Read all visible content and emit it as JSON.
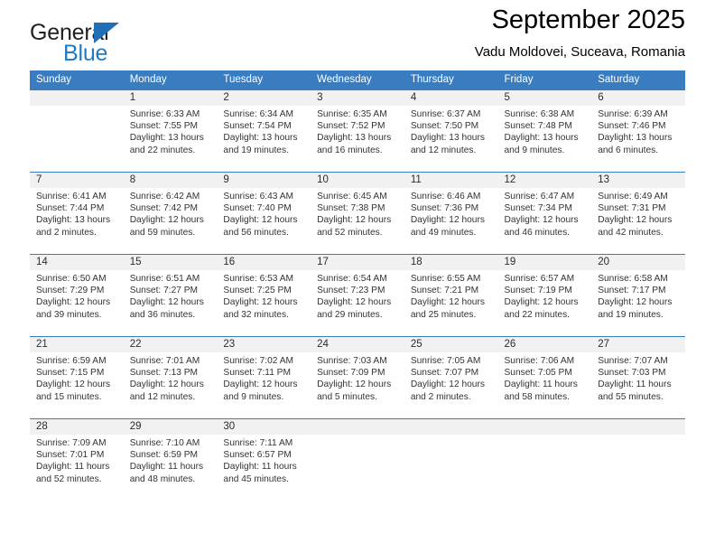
{
  "brand": {
    "name_part1": "General",
    "name_part2": "Blue",
    "accent_color": "#1f7ac4",
    "triangle_color": "#1f6fb5"
  },
  "header": {
    "title": "September 2025",
    "location": "Vadu Moldovei, Suceava, Romania"
  },
  "calendar": {
    "header_bg": "#3a7cc0",
    "daynum_band_bg": "#f1f1f1",
    "weekday_headers": [
      "Sunday",
      "Monday",
      "Tuesday",
      "Wednesday",
      "Thursday",
      "Friday",
      "Saturday"
    ],
    "weeks": [
      [
        {
          "day": "",
          "sunrise": "",
          "sunset": "",
          "daylight1": "",
          "daylight2": ""
        },
        {
          "day": "1",
          "sunrise": "Sunrise: 6:33 AM",
          "sunset": "Sunset: 7:55 PM",
          "daylight1": "Daylight: 13 hours",
          "daylight2": "and 22 minutes."
        },
        {
          "day": "2",
          "sunrise": "Sunrise: 6:34 AM",
          "sunset": "Sunset: 7:54 PM",
          "daylight1": "Daylight: 13 hours",
          "daylight2": "and 19 minutes."
        },
        {
          "day": "3",
          "sunrise": "Sunrise: 6:35 AM",
          "sunset": "Sunset: 7:52 PM",
          "daylight1": "Daylight: 13 hours",
          "daylight2": "and 16 minutes."
        },
        {
          "day": "4",
          "sunrise": "Sunrise: 6:37 AM",
          "sunset": "Sunset: 7:50 PM",
          "daylight1": "Daylight: 13 hours",
          "daylight2": "and 12 minutes."
        },
        {
          "day": "5",
          "sunrise": "Sunrise: 6:38 AM",
          "sunset": "Sunset: 7:48 PM",
          "daylight1": "Daylight: 13 hours",
          "daylight2": "and 9 minutes."
        },
        {
          "day": "6",
          "sunrise": "Sunrise: 6:39 AM",
          "sunset": "Sunset: 7:46 PM",
          "daylight1": "Daylight: 13 hours",
          "daylight2": "and 6 minutes."
        }
      ],
      [
        {
          "day": "7",
          "sunrise": "Sunrise: 6:41 AM",
          "sunset": "Sunset: 7:44 PM",
          "daylight1": "Daylight: 13 hours",
          "daylight2": "and 2 minutes."
        },
        {
          "day": "8",
          "sunrise": "Sunrise: 6:42 AM",
          "sunset": "Sunset: 7:42 PM",
          "daylight1": "Daylight: 12 hours",
          "daylight2": "and 59 minutes."
        },
        {
          "day": "9",
          "sunrise": "Sunrise: 6:43 AM",
          "sunset": "Sunset: 7:40 PM",
          "daylight1": "Daylight: 12 hours",
          "daylight2": "and 56 minutes."
        },
        {
          "day": "10",
          "sunrise": "Sunrise: 6:45 AM",
          "sunset": "Sunset: 7:38 PM",
          "daylight1": "Daylight: 12 hours",
          "daylight2": "and 52 minutes."
        },
        {
          "day": "11",
          "sunrise": "Sunrise: 6:46 AM",
          "sunset": "Sunset: 7:36 PM",
          "daylight1": "Daylight: 12 hours",
          "daylight2": "and 49 minutes."
        },
        {
          "day": "12",
          "sunrise": "Sunrise: 6:47 AM",
          "sunset": "Sunset: 7:34 PM",
          "daylight1": "Daylight: 12 hours",
          "daylight2": "and 46 minutes."
        },
        {
          "day": "13",
          "sunrise": "Sunrise: 6:49 AM",
          "sunset": "Sunset: 7:31 PM",
          "daylight1": "Daylight: 12 hours",
          "daylight2": "and 42 minutes."
        }
      ],
      [
        {
          "day": "14",
          "sunrise": "Sunrise: 6:50 AM",
          "sunset": "Sunset: 7:29 PM",
          "daylight1": "Daylight: 12 hours",
          "daylight2": "and 39 minutes."
        },
        {
          "day": "15",
          "sunrise": "Sunrise: 6:51 AM",
          "sunset": "Sunset: 7:27 PM",
          "daylight1": "Daylight: 12 hours",
          "daylight2": "and 36 minutes."
        },
        {
          "day": "16",
          "sunrise": "Sunrise: 6:53 AM",
          "sunset": "Sunset: 7:25 PM",
          "daylight1": "Daylight: 12 hours",
          "daylight2": "and 32 minutes."
        },
        {
          "day": "17",
          "sunrise": "Sunrise: 6:54 AM",
          "sunset": "Sunset: 7:23 PM",
          "daylight1": "Daylight: 12 hours",
          "daylight2": "and 29 minutes."
        },
        {
          "day": "18",
          "sunrise": "Sunrise: 6:55 AM",
          "sunset": "Sunset: 7:21 PM",
          "daylight1": "Daylight: 12 hours",
          "daylight2": "and 25 minutes."
        },
        {
          "day": "19",
          "sunrise": "Sunrise: 6:57 AM",
          "sunset": "Sunset: 7:19 PM",
          "daylight1": "Daylight: 12 hours",
          "daylight2": "and 22 minutes."
        },
        {
          "day": "20",
          "sunrise": "Sunrise: 6:58 AM",
          "sunset": "Sunset: 7:17 PM",
          "daylight1": "Daylight: 12 hours",
          "daylight2": "and 19 minutes."
        }
      ],
      [
        {
          "day": "21",
          "sunrise": "Sunrise: 6:59 AM",
          "sunset": "Sunset: 7:15 PM",
          "daylight1": "Daylight: 12 hours",
          "daylight2": "and 15 minutes."
        },
        {
          "day": "22",
          "sunrise": "Sunrise: 7:01 AM",
          "sunset": "Sunset: 7:13 PM",
          "daylight1": "Daylight: 12 hours",
          "daylight2": "and 12 minutes."
        },
        {
          "day": "23",
          "sunrise": "Sunrise: 7:02 AM",
          "sunset": "Sunset: 7:11 PM",
          "daylight1": "Daylight: 12 hours",
          "daylight2": "and 9 minutes."
        },
        {
          "day": "24",
          "sunrise": "Sunrise: 7:03 AM",
          "sunset": "Sunset: 7:09 PM",
          "daylight1": "Daylight: 12 hours",
          "daylight2": "and 5 minutes."
        },
        {
          "day": "25",
          "sunrise": "Sunrise: 7:05 AM",
          "sunset": "Sunset: 7:07 PM",
          "daylight1": "Daylight: 12 hours",
          "daylight2": "and 2 minutes."
        },
        {
          "day": "26",
          "sunrise": "Sunrise: 7:06 AM",
          "sunset": "Sunset: 7:05 PM",
          "daylight1": "Daylight: 11 hours",
          "daylight2": "and 58 minutes."
        },
        {
          "day": "27",
          "sunrise": "Sunrise: 7:07 AM",
          "sunset": "Sunset: 7:03 PM",
          "daylight1": "Daylight: 11 hours",
          "daylight2": "and 55 minutes."
        }
      ],
      [
        {
          "day": "28",
          "sunrise": "Sunrise: 7:09 AM",
          "sunset": "Sunset: 7:01 PM",
          "daylight1": "Daylight: 11 hours",
          "daylight2": "and 52 minutes."
        },
        {
          "day": "29",
          "sunrise": "Sunrise: 7:10 AM",
          "sunset": "Sunset: 6:59 PM",
          "daylight1": "Daylight: 11 hours",
          "daylight2": "and 48 minutes."
        },
        {
          "day": "30",
          "sunrise": "Sunrise: 7:11 AM",
          "sunset": "Sunset: 6:57 PM",
          "daylight1": "Daylight: 11 hours",
          "daylight2": "and 45 minutes."
        },
        {
          "day": "",
          "sunrise": "",
          "sunset": "",
          "daylight1": "",
          "daylight2": ""
        },
        {
          "day": "",
          "sunrise": "",
          "sunset": "",
          "daylight1": "",
          "daylight2": ""
        },
        {
          "day": "",
          "sunrise": "",
          "sunset": "",
          "daylight1": "",
          "daylight2": ""
        },
        {
          "day": "",
          "sunrise": "",
          "sunset": "",
          "daylight1": "",
          "daylight2": ""
        }
      ]
    ]
  }
}
